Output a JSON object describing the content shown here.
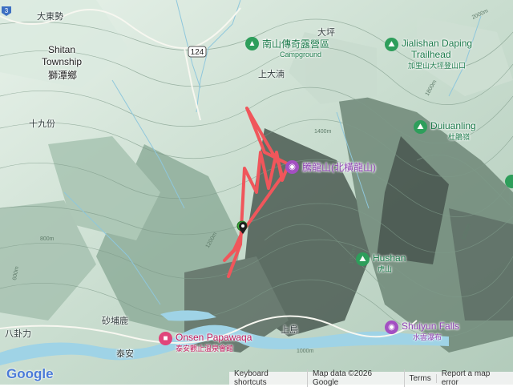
{
  "labels": {
    "dadongshi": "大東勢",
    "shitan_en1": "Shitan",
    "shitan_en2": "Township",
    "shitan_zh": "獅潭鄉",
    "shijiufen": "十九份",
    "daping": "大坪",
    "shangdaqing": "上大湳",
    "bagua_li": "八卦力",
    "shaobulu": "砂埔鹿",
    "taian": "泰安",
    "shangdao": "上島"
  },
  "road_shield": "124",
  "route_badge": "3",
  "contours": {
    "c1400": "1400m",
    "c1600": "1600m",
    "c1800": "1800m",
    "c2000": "2000m",
    "c1200": "1200m",
    "c1000": "1000m",
    "c800": "800m",
    "c600": "600m"
  },
  "pois": {
    "campground": {
      "name": "南山傳奇露營區",
      "sub": "Campground",
      "icon": "tent-icon",
      "color": "#2e9e5b"
    },
    "jialishan": {
      "name1": "Jialishan Daping",
      "name2": "Trailhead",
      "zh": "加里山大坪登山口",
      "icon": "hiker-icon",
      "color": "#2e9e5b"
    },
    "duiuanling": {
      "name": "Duiuanling",
      "zh": "杜鵑嶺",
      "icon": "hiker-icon",
      "color": "#2e9e5b"
    },
    "tenglong": {
      "name": "騰龍山(北橫龍山)",
      "icon": "camera-icon",
      "color": "#a34fc2"
    },
    "hushan": {
      "name": "Hushan",
      "zh": "虎山",
      "icon": "hiker-icon",
      "color": "#2e9e5b"
    },
    "shuiyun": {
      "name": "Shuiyun Falls",
      "zh": "水雲瀑布",
      "icon": "camera-icon",
      "color": "#a34fc2"
    },
    "onsen": {
      "name": "Onsen Papawaqa",
      "zh": "泰安觀止溫泉會館",
      "icon": "hotel-icon",
      "color": "#e0457b"
    }
  },
  "footer": {
    "logo": "Google",
    "shortcuts": "Keyboard shortcuts",
    "map_data": "Map data ©2026 Google",
    "terms": "Terms",
    "report": "Report a map error"
  },
  "colors": {
    "terrain_light": "#dfeee5",
    "terrain_mid": "#b7d4c1",
    "terrain_dark": "#6f8f7c",
    "shadow": "#3f4d45",
    "track": "#f0565b",
    "river": "#9fd3e6",
    "marker": "#1e1e1e",
    "start_marker": "#3fae3f"
  }
}
